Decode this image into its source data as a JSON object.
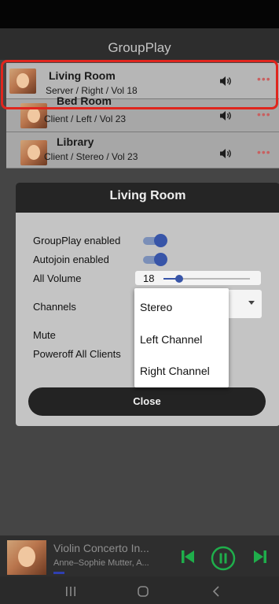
{
  "app": {
    "title": "GroupPlay"
  },
  "devices": [
    {
      "name": "Living Room",
      "detail": "Server / Right / Vol 18",
      "icon": "speaker-icon",
      "menu": "•••"
    },
    {
      "name": "Bed Room",
      "detail": "Client / Left / Vol 23",
      "icon": "speaker-icon",
      "menu": "•••"
    },
    {
      "name": "Library",
      "detail": "Client / Stereo / Vol 23",
      "icon": "speaker-icon",
      "menu": "•••"
    }
  ],
  "dialog": {
    "title": "Living Room",
    "groupplay_label": "GroupPlay enabled",
    "groupplay_enabled": true,
    "autojoin_label": "Autojoin enabled",
    "autojoin_enabled": true,
    "volume_label": "All Volume",
    "volume_value": "18",
    "volume_fraction": 0.18,
    "channels_label": "Channels",
    "mute_label": "Mute",
    "poweroff_label": "Poweroff All Clients",
    "close_label": "Close"
  },
  "channel_options": [
    "Stereo",
    "Left Channel",
    "Right Channel"
  ],
  "player": {
    "title": "Violin Concerto In...",
    "artist": "Anne–Sophie Mutter, A...",
    "controls": [
      "skip-previous-icon",
      "pause-icon",
      "skip-next-icon"
    ]
  },
  "nav": [
    "recent-apps-icon",
    "home-icon",
    "back-icon"
  ],
  "colors": {
    "accent": "#3855a8",
    "player_accent": "#1fae4b",
    "highlight": "#e0261e",
    "menu_dots": "#c86060"
  }
}
